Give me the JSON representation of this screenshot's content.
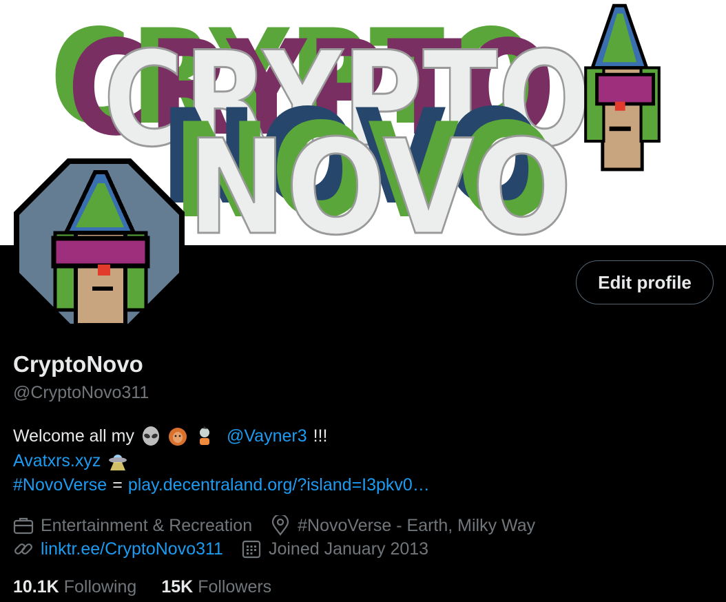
{
  "banner": {
    "line1": "CRYPTO",
    "line2": "NOVO",
    "colors": {
      "green": "#5aa63a",
      "magenta": "#7a2f63",
      "navy": "#27466b",
      "letter": "#eceded"
    }
  },
  "profile": {
    "avatar_bg": "#647d93",
    "edit_label": "Edit profile",
    "name": "CryptoNovo",
    "handle": "@CryptoNovo311",
    "bio": {
      "line1_text": "Welcome all my",
      "emojis": [
        "alien-emoji",
        "orangutan-emoji",
        "zombie-emoji"
      ],
      "mention": "@Vayner3",
      "line1_suffix": "!!!",
      "site_link": "Avatxrs.xyz",
      "site_emoji": "ufo-emoji",
      "hashtag": "#NovoVerse",
      "equals": "=",
      "world_link": "play.decentraland.org/?island=I3pkv0…"
    },
    "category": "Entertainment & Recreation",
    "location": "#NovoVerse - Earth, Milky Way",
    "website": "linktr.ee/CryptoNovo311",
    "joined": "Joined January 2013",
    "following_count": "10.1K",
    "following_label": "Following",
    "followers_count": "15K",
    "followers_label": "Followers"
  },
  "icons": {
    "category": "briefcase-icon",
    "location": "map-pin-icon",
    "website": "link-icon",
    "joined": "calendar-icon"
  },
  "accent": "#1d9bf0"
}
